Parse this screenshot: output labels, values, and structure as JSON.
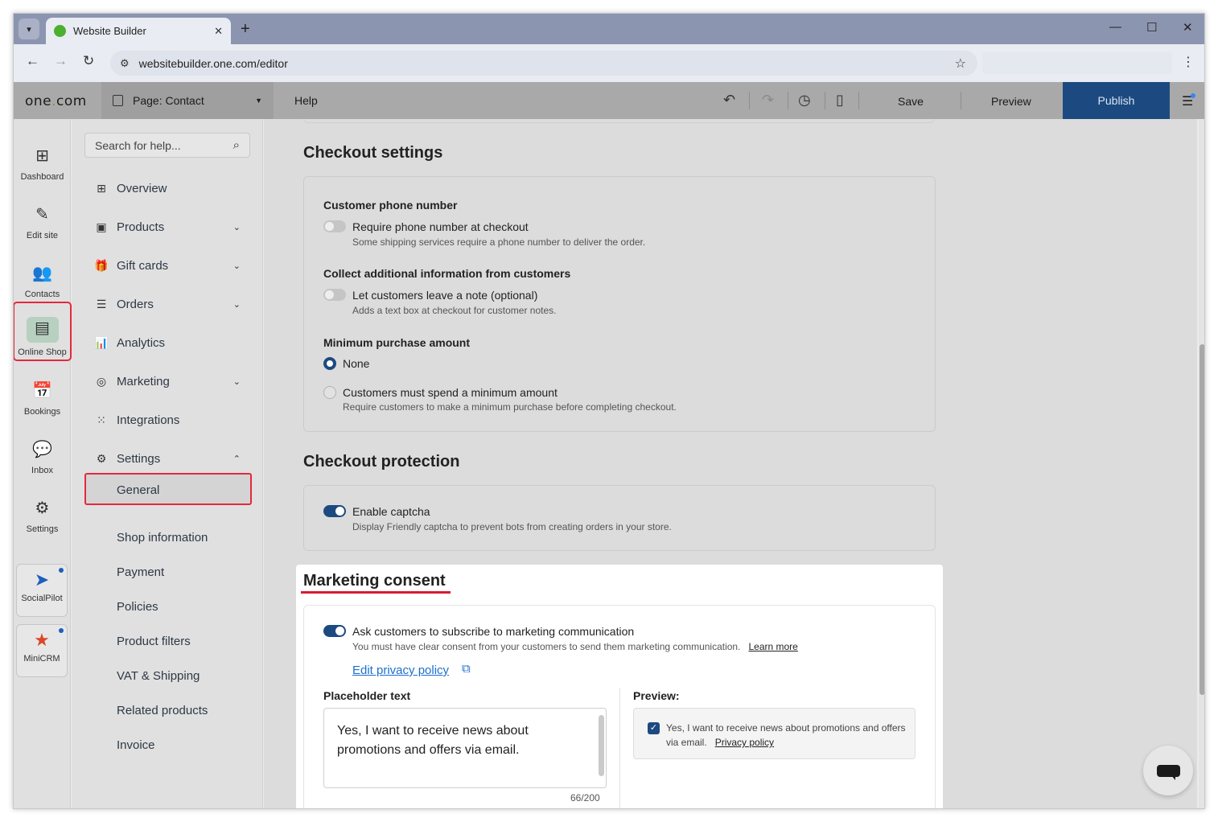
{
  "browser": {
    "tab_title": "Website Builder",
    "tab_close": "✕",
    "new_tab": "+",
    "url": "websitebuilder.one.com/editor"
  },
  "header": {
    "logo_prefix": "one",
    "logo_dot": ".",
    "logo_suffix": "com",
    "page_prefix": "Page:",
    "page_name": "Contact",
    "help": "Help",
    "save": "Save",
    "preview": "Preview",
    "publish": "Publish"
  },
  "rail": {
    "items": [
      {
        "label": "Dashboard",
        "icon": "dashboard-icon"
      },
      {
        "label": "Edit site",
        "icon": "edit-site-icon"
      },
      {
        "label": "Contacts",
        "icon": "contacts-icon"
      },
      {
        "label": "Online Shop",
        "icon": "shop-icon"
      },
      {
        "label": "Bookings",
        "icon": "calendar-icon"
      },
      {
        "label": "Inbox",
        "icon": "inbox-icon"
      },
      {
        "label": "Settings",
        "icon": "gear-icon"
      }
    ],
    "apps": [
      {
        "label": "SocialPilot",
        "icon": "socialpilot-icon"
      },
      {
        "label": "MiniCRM",
        "icon": "minicrm-icon"
      }
    ]
  },
  "sidebar": {
    "search_placeholder": "Search for help...",
    "items": [
      {
        "label": "Overview",
        "icon": "grid-icon"
      },
      {
        "label": "Products",
        "icon": "box-icon"
      },
      {
        "label": "Gift cards",
        "icon": "gift-icon"
      },
      {
        "label": "Orders",
        "icon": "list-icon"
      },
      {
        "label": "Analytics",
        "icon": "chart-icon"
      },
      {
        "label": "Marketing",
        "icon": "target-icon"
      },
      {
        "label": "Integrations",
        "icon": "dots-grid-icon"
      },
      {
        "label": "Settings",
        "icon": "gear-icon"
      }
    ],
    "settings_sub": [
      "General",
      "Shop information",
      "Payment",
      "Policies",
      "Product filters",
      "VAT & Shipping",
      "Related products",
      "Invoice"
    ]
  },
  "checkout_settings": {
    "title": "Checkout settings",
    "phone_label": "Customer phone number",
    "phone_option": "Require phone number at checkout",
    "phone_desc": "Some shipping services require a phone number to deliver the order.",
    "note_label": "Collect additional information from customers",
    "note_option": "Let customers leave a note (optional)",
    "note_desc": "Adds a text box at checkout for customer notes.",
    "min_label": "Minimum purchase amount",
    "min_none": "None",
    "min_custom": "Customers must spend a minimum amount",
    "min_custom_desc": "Require customers to make a minimum purchase before completing checkout."
  },
  "checkout_protection": {
    "title": "Checkout protection",
    "captcha_option": "Enable captcha",
    "captcha_desc": "Display Friendly captcha to prevent bots from creating orders in your store."
  },
  "marketing_consent": {
    "title": "Marketing consent",
    "option": "Ask customers to subscribe to marketing communication",
    "desc": "You must have clear consent from your customers to send them marketing communication.",
    "learn_more": "Learn more",
    "edit_policy": "Edit privacy policy",
    "placeholder_label": "Placeholder text",
    "placeholder_value": "Yes, I want to receive news about promotions and offers via email.",
    "counter": "66/200",
    "preview_label": "Preview:",
    "preview_text": "Yes, I want to receive news about promotions and offers via email.",
    "preview_link": "Privacy policy"
  },
  "colors": {
    "accent": "#1c4a80",
    "highlight": "#e5283f",
    "link": "#1d6fd1"
  }
}
